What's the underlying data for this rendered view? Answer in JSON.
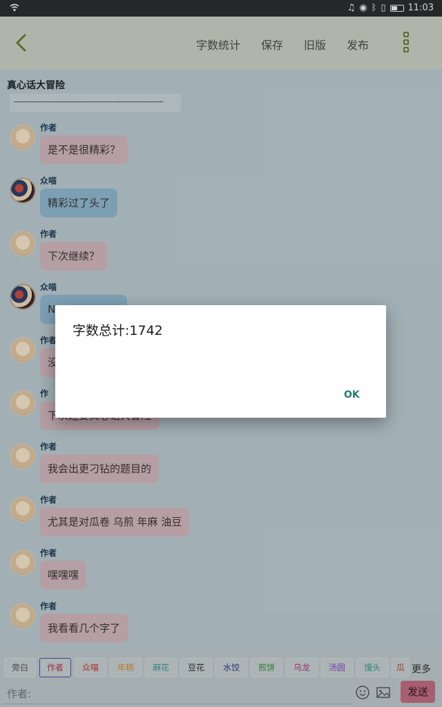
{
  "status_bar": {
    "time": "11:03"
  },
  "toolbar": {
    "menu": [
      "字数统计",
      "保存",
      "旧版",
      "发布"
    ]
  },
  "story": {
    "title": "真心话大冒险",
    "divider": "——————————————————"
  },
  "messages": [
    {
      "sender": "作者",
      "text": "是不是很精彩？",
      "style": "pink",
      "avatar": "author-avatar"
    },
    {
      "sender": "众喵",
      "text": "精彩过了头了",
      "style": "blue",
      "avatar": "crowd-avatar"
    },
    {
      "sender": "作者",
      "text": "下次继续？",
      "style": "pink",
      "avatar": "author-avatar"
    },
    {
      "sender": "众喵",
      "text": "N",
      "style": "blue",
      "avatar": "crowd-avatar"
    },
    {
      "sender": "作者",
      "text": "没",
      "style": "pink",
      "avatar": "author-avatar"
    },
    {
      "sender": "作",
      "text": "下次还要真心话大冒险",
      "style": "pink",
      "avatar": "author-avatar"
    },
    {
      "sender": "作者",
      "text": "我会出更刁钻的题目的",
      "style": "pink",
      "avatar": "author-avatar"
    },
    {
      "sender": "作者",
      "text": "尤其是对瓜卷 乌煎 年麻 油豆",
      "style": "pink",
      "avatar": "author-avatar"
    },
    {
      "sender": "作者",
      "text": "嘿嘿嘿",
      "style": "pink",
      "avatar": "author-avatar"
    },
    {
      "sender": "作者",
      "text": "我看看几个字了",
      "style": "pink",
      "avatar": "author-avatar"
    }
  ],
  "chips": [
    {
      "label": "旁白",
      "color": "#555555"
    },
    {
      "label": "作者",
      "color": "#b2334a"
    },
    {
      "label": "众喵",
      "color": "#c0392b"
    },
    {
      "label": "年糕",
      "color": "#d08a3a"
    },
    {
      "label": "麻花",
      "color": "#3f8f8f"
    },
    {
      "label": "豆花",
      "color": "#333333"
    },
    {
      "label": "水饺",
      "color": "#2e3f8f"
    },
    {
      "label": "煎饼",
      "color": "#3a8f3a"
    },
    {
      "label": "乌龙",
      "color": "#b23a7a"
    },
    {
      "label": "汤圆",
      "color": "#8a4fbf"
    },
    {
      "label": "馒头",
      "color": "#3a9a8a"
    },
    {
      "label": "瓜",
      "color": "#c0392b"
    }
  ],
  "more_label": "更多",
  "input": {
    "placeholder": "作者:"
  },
  "send_label": "发送",
  "dialog": {
    "message": "字数总计:1742",
    "ok_label": "OK"
  }
}
